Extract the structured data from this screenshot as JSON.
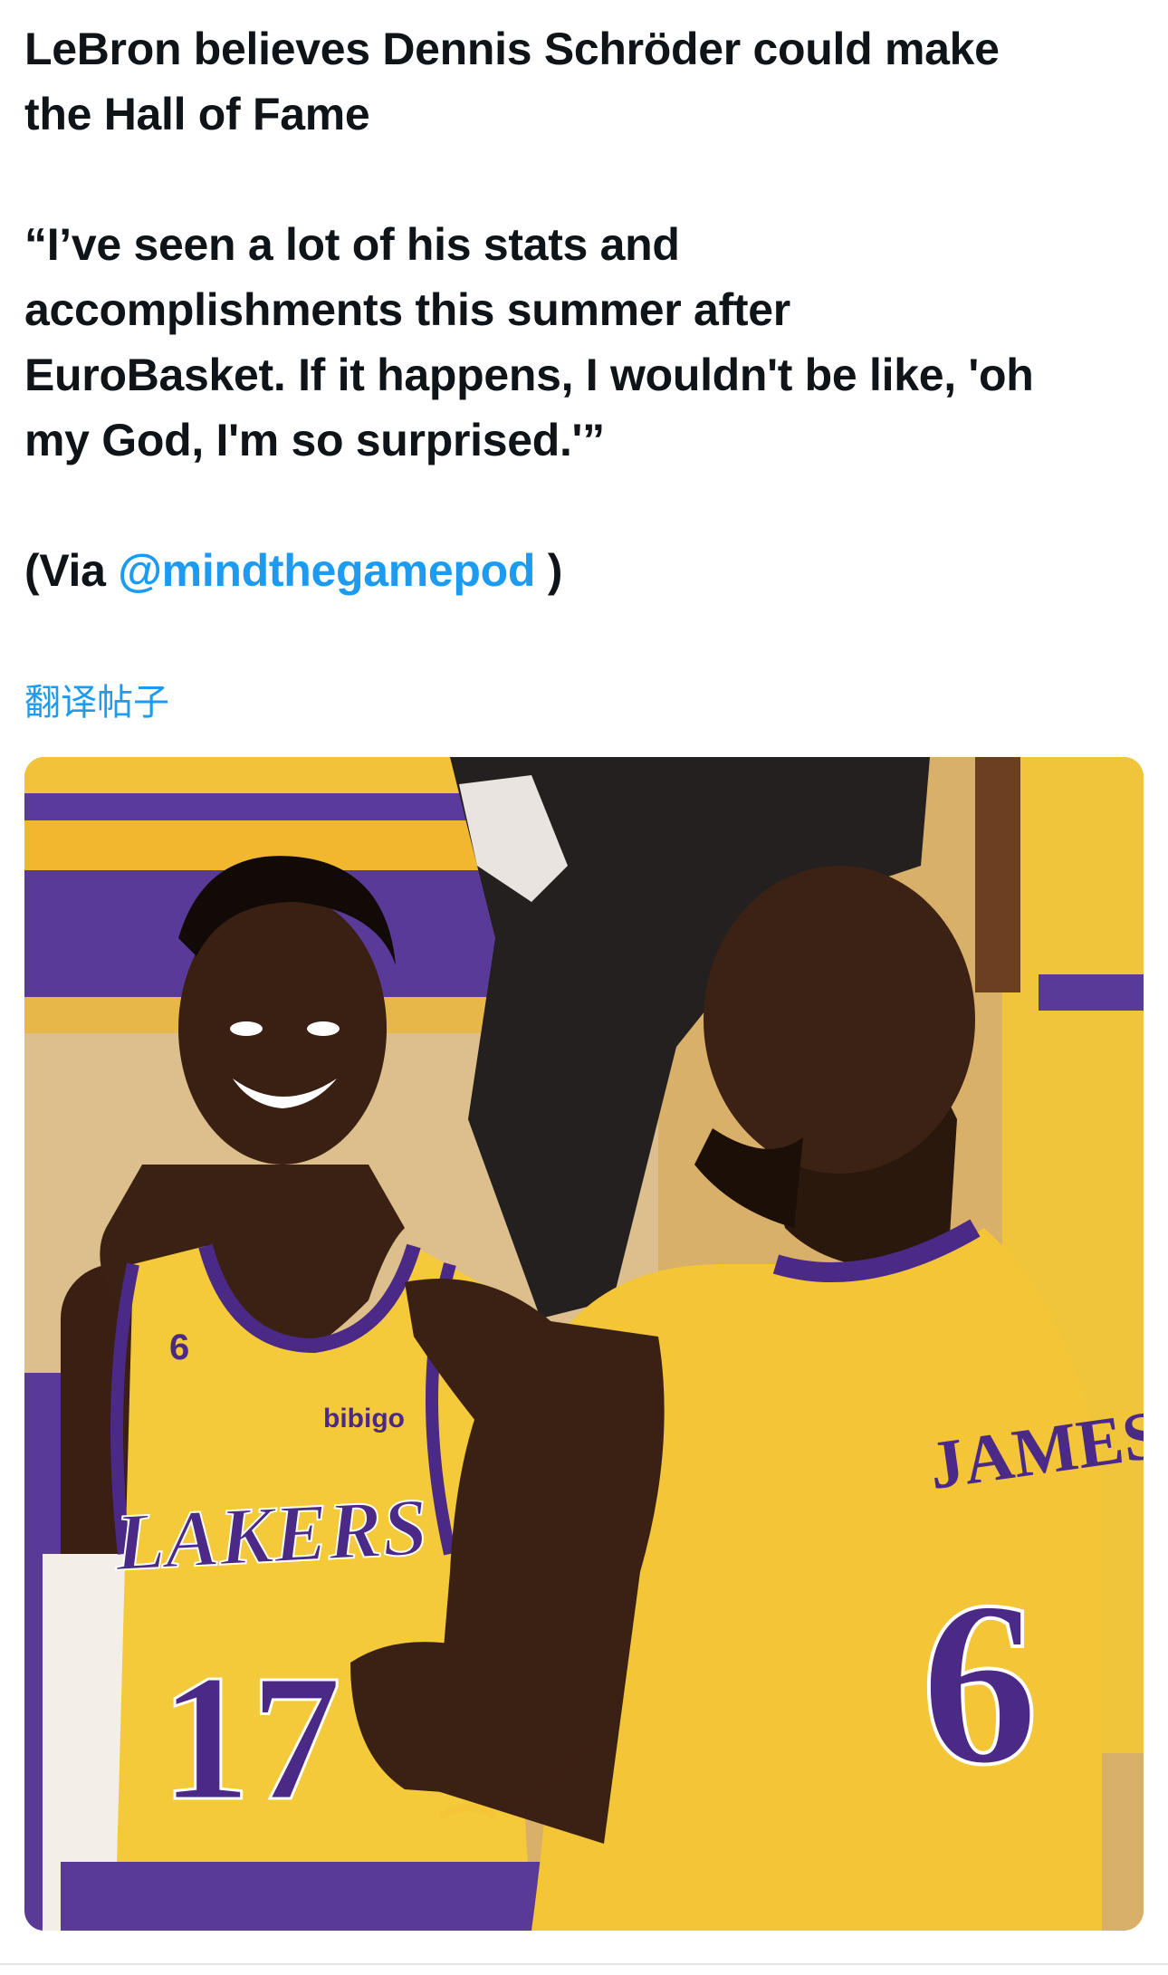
{
  "tweet": {
    "headline_line1": "LeBron believes Dennis Schröder could make",
    "headline_line2": "the Hall of Fame",
    "quote_line1": "“I’ve seen a lot of his stats and",
    "quote_line2": "accomplishments this summer after",
    "quote_line3": "EuroBasket. If it happens, I wouldn't be like, 'oh",
    "quote_line4": "my God, I'm so surprised.'”",
    "via_prefix": "(Via ",
    "via_handle": "@mindthegamepod",
    "via_suffix": " )",
    "translate_link": "翻译帖子"
  },
  "media": {
    "left_jersey_text": "LAKERS",
    "left_jersey_number": "17",
    "left_patch_number": "6",
    "sponsor": "bibigo",
    "right_jersey_name": "JAMES",
    "right_jersey_number": "6"
  },
  "colors": {
    "link": "#1d9bf0",
    "lakers_gold": "#f3c537",
    "lakers_purple": "#4b2a87"
  }
}
